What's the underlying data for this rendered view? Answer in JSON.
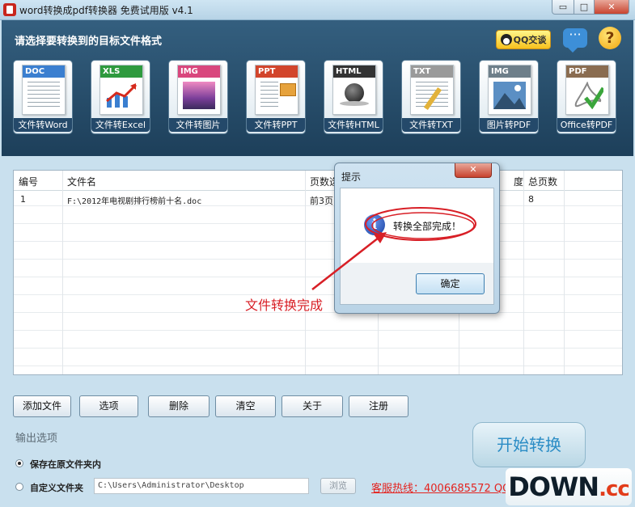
{
  "window": {
    "title": "word转换成pdf转换器 免费试用版 v4.1",
    "minimize": "▭",
    "maximize": "□",
    "close": "✕"
  },
  "header": {
    "heading": "请选择要转换到的目标文件格式",
    "qq_label": "QQ交谈",
    "help_glyph": "?",
    "chat_glyph": "···"
  },
  "tiles": [
    {
      "band": "DOC",
      "label": "文件转Word",
      "color": "#3b7fd0",
      "icon": "word-doc-icon"
    },
    {
      "band": "XLS",
      "label": "文件转Excel",
      "color": "#2e9a3e",
      "icon": "excel-chart-icon"
    },
    {
      "band": "IMG",
      "label": "文件转图片",
      "color": "#d9477d",
      "icon": "image-photo-icon"
    },
    {
      "band": "PPT",
      "label": "文件转PPT",
      "color": "#d2452c",
      "icon": "ppt-slides-icon"
    },
    {
      "band": "HTML",
      "label": "文件转HTML",
      "color": "#333333",
      "icon": "html-globe-icon"
    },
    {
      "band": "TXT",
      "label": "文件转TXT",
      "color": "#9a9a9a",
      "icon": "txt-pen-icon"
    },
    {
      "band": "IMG",
      "label": "图片转PDF",
      "color": "#6e7f8a",
      "icon": "image-to-pdf-icon"
    },
    {
      "band": "PDF",
      "label": "Office转PDF",
      "color": "#8a6c50",
      "icon": "office-pdf-icon"
    }
  ],
  "table": {
    "headers": [
      "编号",
      "文件名",
      "页数选",
      "",
      "",
      "度",
      "总页数"
    ],
    "rows": [
      {
        "no": "1",
        "file": "F:\\2012年电视剧排行榜前十名.doc",
        "pages": "前3页",
        "total": "8"
      }
    ]
  },
  "buttons": {
    "add_file": "添加文件",
    "options": "选项",
    "delete": "删除",
    "clear": "清空",
    "about": "关于",
    "register": "注册",
    "start": "开始转换",
    "browse": "浏览"
  },
  "output": {
    "label": "输出选项",
    "option_save_original": "保存在原文件夹内",
    "option_custom": "自定义文件夹",
    "path_value": "C:\\Users\\Administrator\\Desktop",
    "hotline": "客服热线：4006685572 QQ"
  },
  "dialog": {
    "title": "提示",
    "message": "转换全部完成！",
    "ok": "确定",
    "close": "✕"
  },
  "annotation": {
    "text": "文件转换完成",
    "color": "#d81f26"
  },
  "watermark": {
    "main": "DOWN",
    "suffix": ".cc"
  }
}
